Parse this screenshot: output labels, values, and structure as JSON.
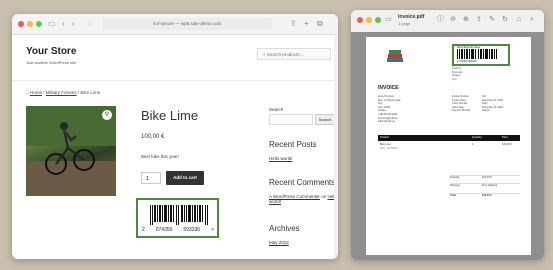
{
  "browser": {
    "url": "not-secure — wp5.sale-demo.com",
    "store_title": "Your Store",
    "store_tagline": "Just another WordPress site",
    "search_placeholder": "Search products…",
    "breadcrumb": [
      "Home",
      "Military Forums",
      "Bike Lime"
    ],
    "product": {
      "title": "Bike Lime",
      "price": "100,00 €",
      "description": "Best bike this year!",
      "quantity": "1",
      "add_to_cart": "Add to cart",
      "barcode": {
        "first": "2",
        "left_group": "074350",
        "right_group": "593336",
        "end": ">"
      }
    },
    "sidebar": {
      "search_label": "Search",
      "search_button": "Search",
      "recent_posts": "Recent Posts",
      "post_link": "Hello world!",
      "recent_comments": "Recent Comments",
      "comment_author": "A WordPress Commenter",
      "comment_on": "on",
      "comment_post": "Hello world!",
      "archives": "Archives",
      "archive_month": "May 2022"
    }
  },
  "viewer": {
    "file_name": "invoice.pdf",
    "page_info": "1 page",
    "invoice": {
      "barcode_label": "Store Barcode Name",
      "barcode_number": "2 074350 593336",
      "ship_to": [
        "Address",
        "Postcode",
        "Ukraine",
        "Kyiv"
      ],
      "heading": "INVOICE",
      "address_lines": [
        "Anna Hromova",
        "Kiev 14 Zhytomyrska",
        "Kyiv",
        "Kyiv, 01601",
        "Ukraine",
        "+380 66 000 0000",
        "hromova@mail.ua",
        "admin@mail.ua"
      ],
      "meta": [
        {
          "k": "Invoice Number:",
          "v": "141"
        },
        {
          "k": "Invoice Date:",
          "v": "December 16, 2022"
        },
        {
          "k": "Order Number:",
          "v": "3613"
        },
        {
          "k": "Order Date:",
          "v": "December 16, 2022"
        },
        {
          "k": "Payment Method:",
          "v": "Paypal"
        }
      ],
      "columns": [
        "Product",
        "Quantity",
        "Price"
      ],
      "row": {
        "product": "Bike Lime",
        "sku": "SKU: 32145644",
        "qty": "1",
        "price": "100,00 €"
      },
      "subtotal_label": "Subtotal",
      "subtotal": "100,00 €",
      "shipping_label": "Shipping",
      "shipping": "Free shipping",
      "total_label": "Total",
      "total": "100,00 €"
    }
  },
  "colors": {
    "highlight": "#4d8a3a",
    "button": "#333333",
    "desktop": "#c9bfae"
  }
}
